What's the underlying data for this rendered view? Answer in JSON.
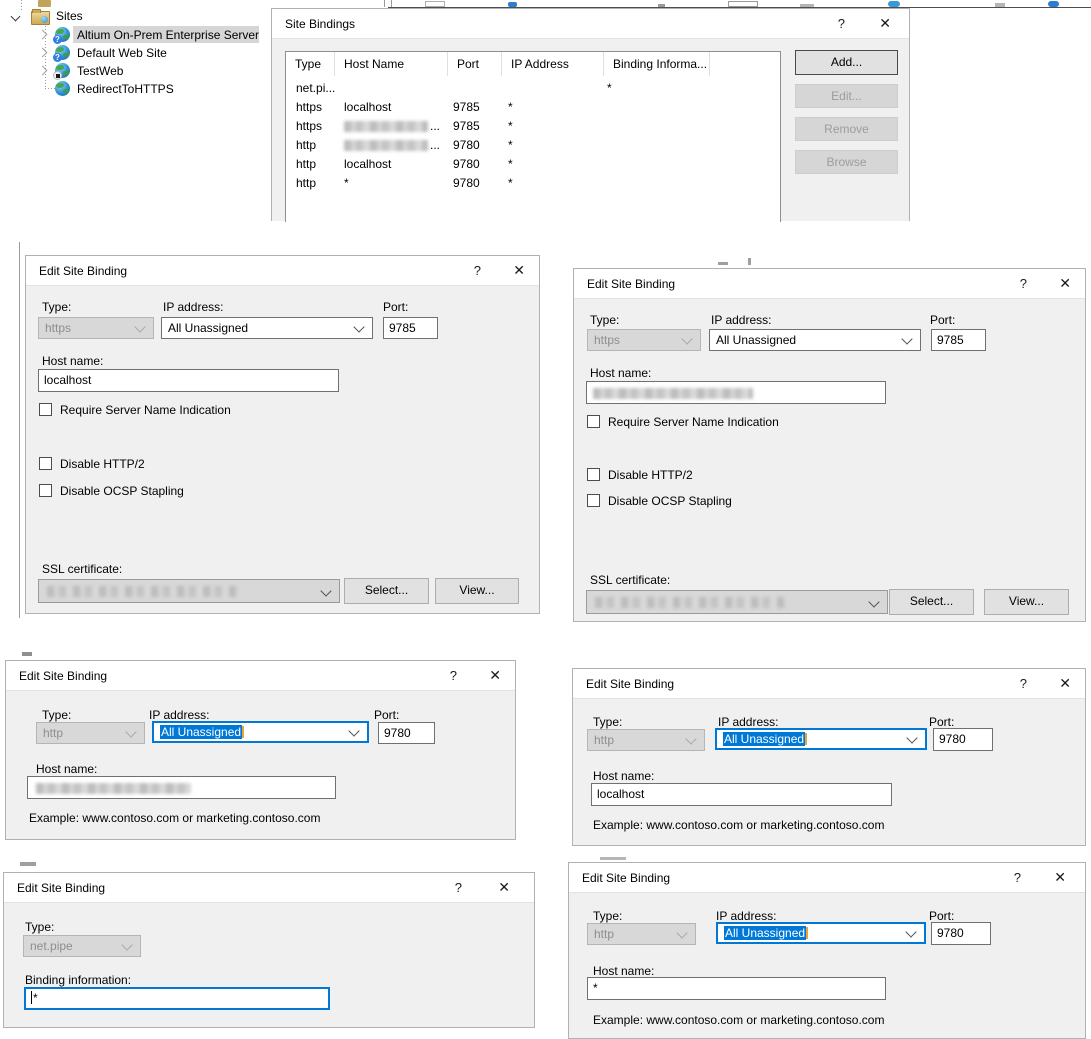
{
  "chrome": {
    "help": "?",
    "close": "✕"
  },
  "colors": {
    "accent": "#0078d7",
    "dialog_body": "#f0f0f0",
    "selection_gray": "#d6d6d6"
  },
  "tree": {
    "root": "Sites",
    "badge_question": "?",
    "items": [
      {
        "label": "Altium On-Prem Enterprise Server",
        "selected": true
      },
      {
        "label": "Default Web Site",
        "selected": false
      },
      {
        "label": "TestWeb",
        "selected": false
      },
      {
        "label": "RedirectToHTTPS",
        "selected": false
      }
    ]
  },
  "site_bindings": {
    "title": "Site Bindings",
    "columns": [
      "Type",
      "Host Name",
      "Port",
      "IP Address",
      "Binding Informa..."
    ],
    "rows": [
      {
        "type": "net.pi...",
        "host": "",
        "port": "",
        "ip": "",
        "info": "*"
      },
      {
        "type": "https",
        "host": "localhost",
        "port": "9785",
        "ip": "*",
        "info": ""
      },
      {
        "type": "https",
        "host": "...",
        "port": "9785",
        "ip": "*",
        "info": "",
        "host_redacted": true
      },
      {
        "type": "http",
        "host": "...",
        "port": "9780",
        "ip": "*",
        "info": "",
        "host_redacted": true
      },
      {
        "type": "http",
        "host": "localhost",
        "port": "9780",
        "ip": "*",
        "info": ""
      },
      {
        "type": "http",
        "host": "*",
        "port": "9780",
        "ip": "*",
        "info": ""
      }
    ],
    "buttons": {
      "add": "Add...",
      "edit": "Edit...",
      "remove": "Remove",
      "browse": "Browse"
    }
  },
  "labels": {
    "title": "Edit Site Binding",
    "type": "Type:",
    "ip": "IP address:",
    "port": "Port:",
    "host": "Host name:",
    "sni": "Require Server Name Indication",
    "http2": "Disable HTTP/2",
    "ocsp": "Disable OCSP Stapling",
    "ssl": "SSL certificate:",
    "select": "Select...",
    "view": "View...",
    "binding_info": "Binding information:",
    "example": "Example: www.contoso.com or marketing.contoso.com"
  },
  "dialogs": {
    "https_localhost": {
      "type": "https",
      "ip": "All Unassigned",
      "port": "9785",
      "host": "localhost"
    },
    "https_redacted": {
      "type": "https",
      "ip": "All Unassigned",
      "port": "9785",
      "host": ""
    },
    "http_redacted": {
      "type": "http",
      "ip": "All Unassigned",
      "port": "9780",
      "host": ""
    },
    "http_localhost": {
      "type": "http",
      "ip": "All Unassigned",
      "port": "9780",
      "host": "localhost"
    },
    "netpipe": {
      "type": "net.pipe",
      "binding": "*"
    },
    "http_star": {
      "type": "http",
      "ip": "All Unassigned",
      "port": "9780",
      "host": "*"
    }
  }
}
